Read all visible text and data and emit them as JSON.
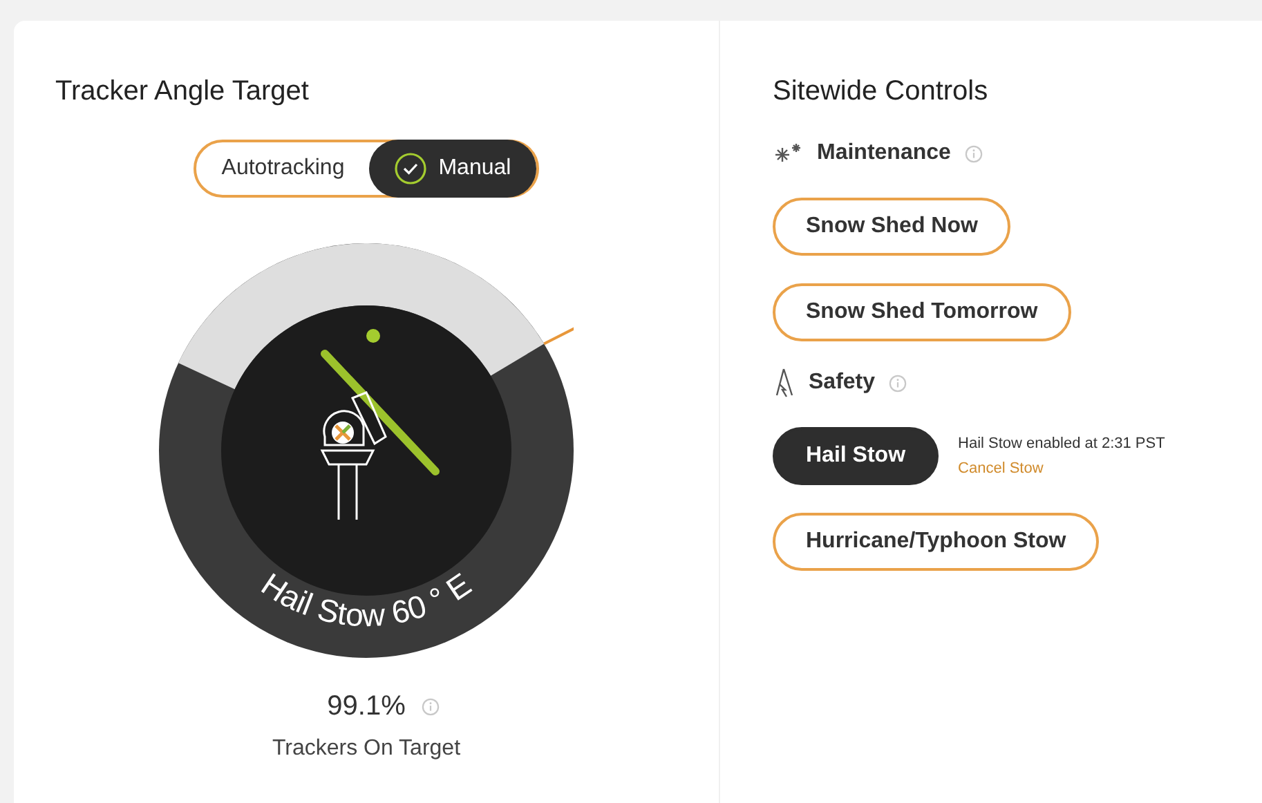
{
  "tracker": {
    "title": "Tracker Angle Target",
    "mode_toggle": [
      {
        "label": "Autotracking",
        "selected": false
      },
      {
        "label": "Manual",
        "selected": true
      }
    ],
    "gauge_label": "Hail Stow 60 ° E",
    "on_target_value": "99.1%",
    "on_target_label": "Trackers On Target"
  },
  "sitewide": {
    "title": "Sitewide Controls",
    "sections": [
      {
        "kind": "maintenance",
        "title": "Maintenance",
        "buttons": [
          {
            "label": "Snow Shed Now",
            "active": false
          },
          {
            "label": "Snow Shed Tomorrow",
            "active": false
          }
        ]
      },
      {
        "kind": "safety",
        "title": "Safety",
        "buttons": [
          {
            "label": "Hail Stow",
            "active": true,
            "status": "Hail Stow enabled at 2:31 PST",
            "action": "Cancel Stow"
          },
          {
            "label": "Hurricane/Typhoon Stow",
            "active": false
          }
        ]
      }
    ]
  }
}
